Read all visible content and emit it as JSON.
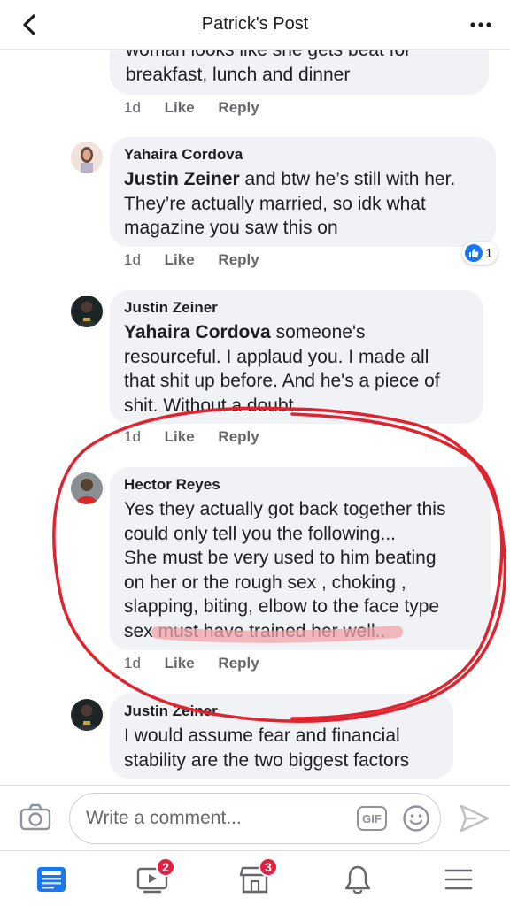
{
  "header": {
    "title": "Patrick's Post"
  },
  "comments": [
    {
      "author": "",
      "mention": "",
      "lines": [
        "woman looks like she gets beat for",
        "breakfast, lunch and dinner"
      ],
      "time": "1d",
      "like_label": "Like",
      "reply_label": "Reply"
    },
    {
      "author": "Yahaira Cordova",
      "mention": "Justin Zeiner",
      "lines": [
        " and btw he’s still with her.",
        "They’re actually married, so idk what",
        "magazine you saw this on"
      ],
      "time": "1d",
      "like_label": "Like",
      "reply_label": "Reply",
      "reaction_count": "1"
    },
    {
      "author": "Justin Zeiner",
      "mention": "Yahaira Cordova",
      "lines": [
        " someone's",
        "resourceful. I applaud you. I made all",
        "that shit up before. And he's a piece of",
        "shit. Without a doubt"
      ],
      "time": "1d",
      "like_label": "Like",
      "reply_label": "Reply"
    },
    {
      "author": "Hector Reyes",
      "mention": "",
      "lines": [
        "Yes they actually got back together this",
        "could only tell you the following...",
        "She must be very used to him beating",
        "on her or the rough sex , choking ,",
        "slapping, biting,  elbow to the face type",
        "sex must have trained her well.."
      ],
      "time": "1d",
      "like_label": "Like",
      "reply_label": "Reply"
    },
    {
      "author": "Justin Zeiner",
      "mention": "",
      "lines": [
        "I would assume fear and financial",
        "stability are the two biggest factors"
      ],
      "time": "",
      "like_label": "",
      "reply_label": ""
    }
  ],
  "composer": {
    "placeholder": "Write a comment...",
    "gif_label": "GIF"
  },
  "nav": {
    "video_badge": "2",
    "marketplace_badge": "3"
  },
  "colors": {
    "accent": "#1877f2",
    "annotation": "#e0242f",
    "badge": "#e41e3f"
  },
  "icons": [
    "back-icon",
    "more-icon",
    "like-thumb-icon",
    "camera-icon",
    "gif-icon",
    "emoji-icon",
    "send-icon",
    "news-feed-icon",
    "video-icon",
    "marketplace-icon",
    "notifications-icon",
    "menu-icon"
  ]
}
